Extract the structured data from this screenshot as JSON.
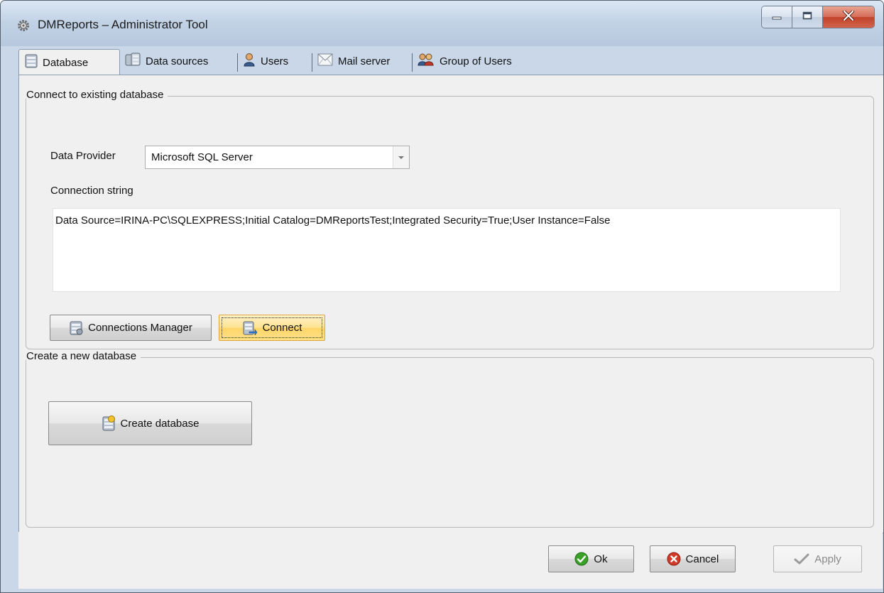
{
  "window": {
    "title": "DMReports – Administrator Tool",
    "icon": "gear-icon"
  },
  "titlebar_buttons": {
    "minimize_icon": "minimize-icon",
    "maximize_icon": "maximize-icon",
    "close_icon": "close-icon"
  },
  "tabs": [
    {
      "label": "Database",
      "icon": "database-icon",
      "active": true
    },
    {
      "label": "Data sources",
      "icon": "data-sources-icon",
      "active": false
    },
    {
      "label": "Users",
      "icon": "user-icon",
      "active": false
    },
    {
      "label": "Mail server",
      "icon": "mail-icon",
      "active": false
    },
    {
      "label": "Group of Users",
      "icon": "group-users-icon",
      "active": false
    }
  ],
  "connect_group": {
    "title": "Connect to existing database",
    "provider_label": "Data Provider",
    "provider_value": "Microsoft SQL Server",
    "connection_label": "Connection string",
    "connection_value": "Data Source=IRINA-PC\\SQLEXPRESS;Initial Catalog=DMReportsTest;Integrated Security=True;User Instance=False",
    "connections_manager_label": "Connections Manager",
    "connect_label": "Connect"
  },
  "create_group": {
    "title": "Create a new database",
    "create_label": "Create database"
  },
  "footer": {
    "ok_label": "Ok",
    "cancel_label": "Cancel",
    "apply_label": "Apply"
  },
  "colors": {
    "ok_icon": "#3aa028",
    "cancel_icon": "#d23a2a",
    "highlight_button": "#ffd566"
  }
}
